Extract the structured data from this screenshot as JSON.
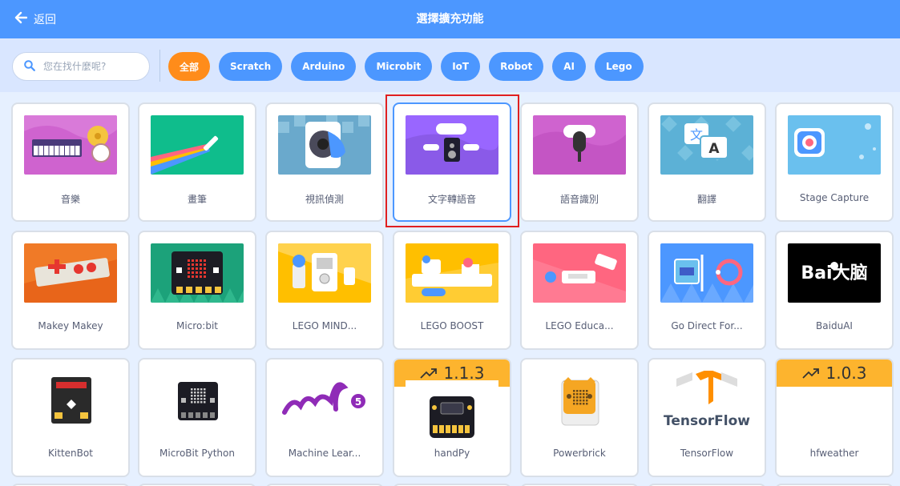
{
  "header": {
    "back_label": "返回",
    "title": "選擇擴充功能"
  },
  "search": {
    "placeholder": "您在找什麼呢?"
  },
  "tags": [
    {
      "label": "全部",
      "color": "#ff8c1a",
      "active": true
    },
    {
      "label": "Scratch",
      "color": "#4c97ff"
    },
    {
      "label": "Arduino",
      "color": "#4c97ff"
    },
    {
      "label": "Microbit",
      "color": "#4c97ff"
    },
    {
      "label": "IoT",
      "color": "#4c97ff"
    },
    {
      "label": "Robot",
      "color": "#4c97ff"
    },
    {
      "label": "AI",
      "color": "#4c97ff"
    },
    {
      "label": "Lego",
      "color": "#4c97ff"
    }
  ],
  "extensions": [
    {
      "label": "音樂",
      "icon": "music-keyboard-icon"
    },
    {
      "label": "畫筆",
      "icon": "pen-rainbow-icon"
    },
    {
      "label": "視訊偵測",
      "icon": "video-sensing-icon"
    },
    {
      "label": "文字轉語音",
      "icon": "text-to-speech-icon",
      "selected": true
    },
    {
      "label": "語音識別",
      "icon": "microphone-icon"
    },
    {
      "label": "翻譯",
      "icon": "translate-icon"
    },
    {
      "label": "Stage Capture",
      "icon": "camera-icon"
    },
    {
      "label": "Makey Makey",
      "icon": "makey-makey-board-icon"
    },
    {
      "label": "Micro:bit",
      "icon": "microbit-board-icon"
    },
    {
      "label": "LEGO MIND...",
      "icon": "lego-mindstorms-icon"
    },
    {
      "label": "LEGO BOOST",
      "icon": "lego-boost-icon"
    },
    {
      "label": "LEGO Educa...",
      "icon": "lego-education-icon"
    },
    {
      "label": "Go Direct For...",
      "icon": "force-sensor-icon"
    },
    {
      "label": "BaiduAI",
      "icon": "baidu-brain-logo",
      "logo_text": "Bai大脑"
    },
    {
      "label": "KittenBot",
      "icon": "kittenbot-board-icon"
    },
    {
      "label": "MicroBit Python",
      "icon": "microbit-python-icon"
    },
    {
      "label": "Machine Lear...",
      "icon": "ml5-logo",
      "logo_text": "ml5"
    },
    {
      "label": "handPy",
      "icon": "handpy-board-icon",
      "version": "1.1.3"
    },
    {
      "label": "Powerbrick",
      "icon": "powerbrick-icon"
    },
    {
      "label": "TensorFlow",
      "icon": "tensorflow-logo",
      "logo_text": "TensorFlow"
    },
    {
      "label": "hfweather",
      "icon": "weather-icon",
      "version": "1.0.3"
    }
  ],
  "colors": {
    "header": "#4c97ff",
    "filter_bar": "#d9e6ff",
    "grid_bg": "#e6f0ff",
    "active_tag": "#ff8c1a",
    "version_badge": "#fdb42e",
    "selection_outline": "#e02020"
  }
}
